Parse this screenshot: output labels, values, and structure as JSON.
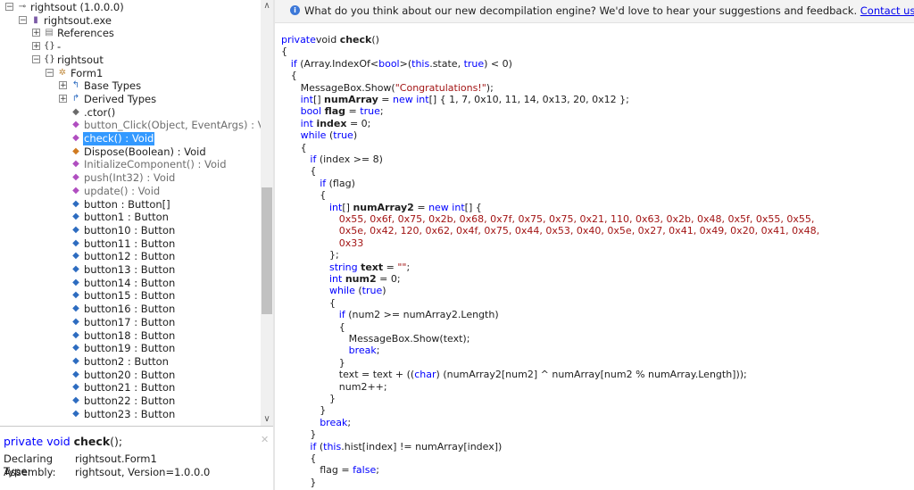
{
  "tree": [
    {
      "label": "rightsout (1.0.0.0)",
      "indent": 0,
      "expander": "−",
      "icon": "assembly-icon",
      "glyph": "⊸",
      "color": "#5a5a5a",
      "selected": false
    },
    {
      "label": "rightsout.exe",
      "indent": 1,
      "expander": "−",
      "icon": "module-icon",
      "glyph": "▮",
      "color": "#7b5aa6",
      "selected": false
    },
    {
      "label": "References",
      "indent": 2,
      "expander": "+",
      "icon": "references-folder-icon",
      "glyph": "▤",
      "color": "#7a7a7a",
      "selected": false
    },
    {
      "label": "-",
      "indent": 2,
      "expander": "+",
      "icon": "namespace-icon",
      "glyph": "{}",
      "color": "#333333",
      "selected": false
    },
    {
      "label": "rightsout",
      "indent": 2,
      "expander": "−",
      "icon": "namespace-icon",
      "glyph": "{}",
      "color": "#333333",
      "selected": false
    },
    {
      "label": "Form1",
      "indent": 3,
      "expander": "−",
      "icon": "class-icon",
      "glyph": "✲",
      "color": "#c08a3e",
      "selected": false
    },
    {
      "label": "Base Types",
      "indent": 4,
      "expander": "+",
      "icon": "base-types-icon",
      "glyph": "↰",
      "color": "#2d6cc0",
      "selected": false
    },
    {
      "label": "Derived Types",
      "indent": 4,
      "expander": "+",
      "icon": "derived-types-icon",
      "glyph": "↱",
      "color": "#2d6cc0",
      "selected": false
    },
    {
      "label": ".ctor()",
      "indent": 4,
      "expander": "",
      "icon": "constructor-icon",
      "glyph": "◆",
      "color": "#6a6a6a",
      "selected": false
    },
    {
      "label": "button_Click(Object, EventArgs) : Void",
      "indent": 4,
      "expander": "",
      "icon": "private-method-icon",
      "glyph": "◆",
      "color": "#b04ec0",
      "selected": false,
      "dim": true
    },
    {
      "label": "check() : Void",
      "indent": 4,
      "expander": "",
      "icon": "private-method-icon",
      "glyph": "◆",
      "color": "#b04ec0",
      "selected": true
    },
    {
      "label": "Dispose(Boolean) : Void",
      "indent": 4,
      "expander": "",
      "icon": "protected-method-icon",
      "glyph": "◆",
      "color": "#d07a20",
      "selected": false
    },
    {
      "label": "InitializeComponent() : Void",
      "indent": 4,
      "expander": "",
      "icon": "private-method-icon",
      "glyph": "◆",
      "color": "#b04ec0",
      "selected": false,
      "dim": true
    },
    {
      "label": "push(Int32) : Void",
      "indent": 4,
      "expander": "",
      "icon": "private-method-icon",
      "glyph": "◆",
      "color": "#b04ec0",
      "selected": false,
      "dim": true
    },
    {
      "label": "update() : Void",
      "indent": 4,
      "expander": "",
      "icon": "private-method-icon",
      "glyph": "◆",
      "color": "#b04ec0",
      "selected": false,
      "dim": true
    },
    {
      "label": "button : Button[]",
      "indent": 4,
      "expander": "",
      "icon": "field-icon",
      "glyph": "◆",
      "color": "#2d6cc0",
      "selected": false
    },
    {
      "label": "button1 : Button",
      "indent": 4,
      "expander": "",
      "icon": "field-icon",
      "glyph": "◆",
      "color": "#2d6cc0",
      "selected": false
    },
    {
      "label": "button10 : Button",
      "indent": 4,
      "expander": "",
      "icon": "field-icon",
      "glyph": "◆",
      "color": "#2d6cc0",
      "selected": false
    },
    {
      "label": "button11 : Button",
      "indent": 4,
      "expander": "",
      "icon": "field-icon",
      "glyph": "◆",
      "color": "#2d6cc0",
      "selected": false
    },
    {
      "label": "button12 : Button",
      "indent": 4,
      "expander": "",
      "icon": "field-icon",
      "glyph": "◆",
      "color": "#2d6cc0",
      "selected": false
    },
    {
      "label": "button13 : Button",
      "indent": 4,
      "expander": "",
      "icon": "field-icon",
      "glyph": "◆",
      "color": "#2d6cc0",
      "selected": false
    },
    {
      "label": "button14 : Button",
      "indent": 4,
      "expander": "",
      "icon": "field-icon",
      "glyph": "◆",
      "color": "#2d6cc0",
      "selected": false
    },
    {
      "label": "button15 : Button",
      "indent": 4,
      "expander": "",
      "icon": "field-icon",
      "glyph": "◆",
      "color": "#2d6cc0",
      "selected": false
    },
    {
      "label": "button16 : Button",
      "indent": 4,
      "expander": "",
      "icon": "field-icon",
      "glyph": "◆",
      "color": "#2d6cc0",
      "selected": false
    },
    {
      "label": "button17 : Button",
      "indent": 4,
      "expander": "",
      "icon": "field-icon",
      "glyph": "◆",
      "color": "#2d6cc0",
      "selected": false
    },
    {
      "label": "button18 : Button",
      "indent": 4,
      "expander": "",
      "icon": "field-icon",
      "glyph": "◆",
      "color": "#2d6cc0",
      "selected": false
    },
    {
      "label": "button19 : Button",
      "indent": 4,
      "expander": "",
      "icon": "field-icon",
      "glyph": "◆",
      "color": "#2d6cc0",
      "selected": false
    },
    {
      "label": "button2 : Button",
      "indent": 4,
      "expander": "",
      "icon": "field-icon",
      "glyph": "◆",
      "color": "#2d6cc0",
      "selected": false
    },
    {
      "label": "button20 : Button",
      "indent": 4,
      "expander": "",
      "icon": "field-icon",
      "glyph": "◆",
      "color": "#2d6cc0",
      "selected": false
    },
    {
      "label": "button21 : Button",
      "indent": 4,
      "expander": "",
      "icon": "field-icon",
      "glyph": "◆",
      "color": "#2d6cc0",
      "selected": false
    },
    {
      "label": "button22 : Button",
      "indent": 4,
      "expander": "",
      "icon": "field-icon",
      "glyph": "◆",
      "color": "#2d6cc0",
      "selected": false
    },
    {
      "label": "button23 : Button",
      "indent": 4,
      "expander": "",
      "icon": "field-icon",
      "glyph": "◆",
      "color": "#2d6cc0",
      "selected": false
    }
  ],
  "info": {
    "sig_kw1": "private",
    "sig_kw2": "void",
    "sig_name": "check",
    "sig_tail": "();",
    "declaring_label": "Declaring Type:",
    "declaring_value": "rightsout.Form1",
    "assembly_label": "Assembly:",
    "assembly_value": "rightsout, Version=1.0.0.0",
    "close_glyph": "✕"
  },
  "banner": {
    "message": "What do you think about our new decompilation engine? We'd love to hear your suggestions and feedback.",
    "link": "Contact us",
    "icon": "info-icon"
  },
  "code_lines": [
    {
      "indent": 0,
      "tokens": [
        [
          "k",
          "private"
        ],
        [
          "",
          "void "
        ],
        [
          "b",
          "check"
        ],
        [
          "",
          "()"
        ]
      ]
    },
    {
      "indent": 0,
      "tokens": [
        [
          "",
          "{"
        ]
      ]
    },
    {
      "indent": 1,
      "tokens": [
        [
          "k",
          "if"
        ],
        [
          "",
          " (Array.IndexOf<"
        ],
        [
          "k",
          "bool"
        ],
        [
          "",
          ">("
        ],
        [
          "k",
          "this"
        ],
        [
          "",
          ".state, "
        ],
        [
          "k",
          "true"
        ],
        [
          "",
          ") < 0)"
        ]
      ]
    },
    {
      "indent": 1,
      "tokens": [
        [
          "",
          "{"
        ]
      ]
    },
    {
      "indent": 2,
      "tokens": [
        [
          "",
          "MessageBox.Show("
        ],
        [
          "s",
          "\"Congratulations!\""
        ],
        [
          "",
          ");"
        ]
      ]
    },
    {
      "indent": 2,
      "tokens": [
        [
          "k",
          "int"
        ],
        [
          "",
          "[] "
        ],
        [
          "b",
          "numArray"
        ],
        [
          "",
          " = "
        ],
        [
          "k",
          "new"
        ],
        [
          "",
          ""
        ],
        [
          "k",
          " int"
        ],
        [
          "",
          "[] { 1, 7, 0x10, 11, 14, 0x13, 20, 0x12 };"
        ]
      ]
    },
    {
      "indent": 2,
      "tokens": [
        [
          "k",
          "bool"
        ],
        [
          "",
          " "
        ],
        [
          "b",
          "flag"
        ],
        [
          "",
          " = "
        ],
        [
          "k",
          "true"
        ],
        [
          "",
          ";"
        ]
      ]
    },
    {
      "indent": 2,
      "tokens": [
        [
          "k",
          "int"
        ],
        [
          "",
          " "
        ],
        [
          "b",
          "index"
        ],
        [
          "",
          " = 0;"
        ]
      ]
    },
    {
      "indent": 2,
      "tokens": [
        [
          "k",
          "while"
        ],
        [
          "",
          " ("
        ],
        [
          "k",
          "true"
        ],
        [
          "",
          ")"
        ]
      ]
    },
    {
      "indent": 2,
      "tokens": [
        [
          "",
          "{"
        ]
      ]
    },
    {
      "indent": 3,
      "tokens": [
        [
          "k",
          "if"
        ],
        [
          "",
          " (index >= 8)"
        ]
      ]
    },
    {
      "indent": 3,
      "tokens": [
        [
          "",
          "{"
        ]
      ]
    },
    {
      "indent": 4,
      "tokens": [
        [
          "k",
          "if"
        ],
        [
          "",
          " (flag)"
        ]
      ]
    },
    {
      "indent": 4,
      "tokens": [
        [
          "",
          "{"
        ]
      ]
    },
    {
      "indent": 5,
      "tokens": [
        [
          "k",
          "int"
        ],
        [
          "",
          "[] "
        ],
        [
          "b",
          "numArray2"
        ],
        [
          "",
          " = "
        ],
        [
          "k",
          "new"
        ],
        [
          "k",
          " int"
        ],
        [
          "",
          "[] {"
        ]
      ]
    },
    {
      "indent": 6,
      "tokens": [
        [
          "s",
          "0x55, 0x6f, 0x75, 0x2b, 0x68, 0x7f, 0x75, 0x75, 0x21, 110, 0x63, 0x2b, 0x48, 0x5f, 0x55, 0x55,"
        ]
      ]
    },
    {
      "indent": 6,
      "tokens": [
        [
          "s",
          "0x5e, 0x42, 120, 0x62, 0x4f, 0x75, 0x44, 0x53, 0x40, 0x5e, 0x27, 0x41, 0x49, 0x20, 0x41, 0x48,"
        ]
      ]
    },
    {
      "indent": 6,
      "tokens": [
        [
          "s",
          "0x33"
        ]
      ]
    },
    {
      "indent": 5,
      "tokens": [
        [
          "",
          "};"
        ]
      ]
    },
    {
      "indent": 5,
      "tokens": [
        [
          "k",
          "string"
        ],
        [
          "",
          " "
        ],
        [
          "b",
          "text"
        ],
        [
          "",
          " = "
        ],
        [
          "s",
          "\"\""
        ],
        [
          "",
          ";"
        ]
      ]
    },
    {
      "indent": 5,
      "tokens": [
        [
          "k",
          "int"
        ],
        [
          "",
          " "
        ],
        [
          "b",
          "num2"
        ],
        [
          "",
          " = 0;"
        ]
      ]
    },
    {
      "indent": 5,
      "tokens": [
        [
          "k",
          "while"
        ],
        [
          "",
          " ("
        ],
        [
          "k",
          "true"
        ],
        [
          "",
          ")"
        ]
      ]
    },
    {
      "indent": 5,
      "tokens": [
        [
          "",
          "{"
        ]
      ]
    },
    {
      "indent": 6,
      "tokens": [
        [
          "k",
          "if"
        ],
        [
          "",
          " (num2 >= numArray2.Length)"
        ]
      ]
    },
    {
      "indent": 6,
      "tokens": [
        [
          "",
          "{"
        ]
      ]
    },
    {
      "indent": 7,
      "tokens": [
        [
          "",
          "MessageBox.Show(text);"
        ]
      ]
    },
    {
      "indent": 7,
      "tokens": [
        [
          "k",
          "break"
        ],
        [
          "",
          ";"
        ]
      ]
    },
    {
      "indent": 6,
      "tokens": [
        [
          "",
          "}"
        ]
      ]
    },
    {
      "indent": 6,
      "tokens": [
        [
          "",
          "text = text + (("
        ],
        [
          "k",
          "char"
        ],
        [
          "",
          ") (numArray2[num2] ^ numArray[num2 % numArray.Length]));"
        ]
      ]
    },
    {
      "indent": 6,
      "tokens": [
        [
          "",
          "num2++;"
        ]
      ]
    },
    {
      "indent": 5,
      "tokens": [
        [
          "",
          "}"
        ]
      ]
    },
    {
      "indent": 4,
      "tokens": [
        [
          "",
          "}"
        ]
      ]
    },
    {
      "indent": 4,
      "tokens": [
        [
          "k",
          "break"
        ],
        [
          "",
          ";"
        ]
      ]
    },
    {
      "indent": 3,
      "tokens": [
        [
          "",
          "}"
        ]
      ]
    },
    {
      "indent": 3,
      "tokens": [
        [
          "k",
          "if"
        ],
        [
          "",
          " ("
        ],
        [
          "k",
          "this"
        ],
        [
          "",
          ".hist[index] != numArray[index])"
        ]
      ]
    },
    {
      "indent": 3,
      "tokens": [
        [
          "",
          "{"
        ]
      ]
    },
    {
      "indent": 4,
      "tokens": [
        [
          "",
          "flag = "
        ],
        [
          "k",
          "false"
        ],
        [
          "",
          ";"
        ]
      ]
    },
    {
      "indent": 3,
      "tokens": [
        [
          "",
          "}"
        ]
      ]
    }
  ],
  "scroll": {
    "up_glyph": "∧",
    "down_glyph": "∨"
  }
}
